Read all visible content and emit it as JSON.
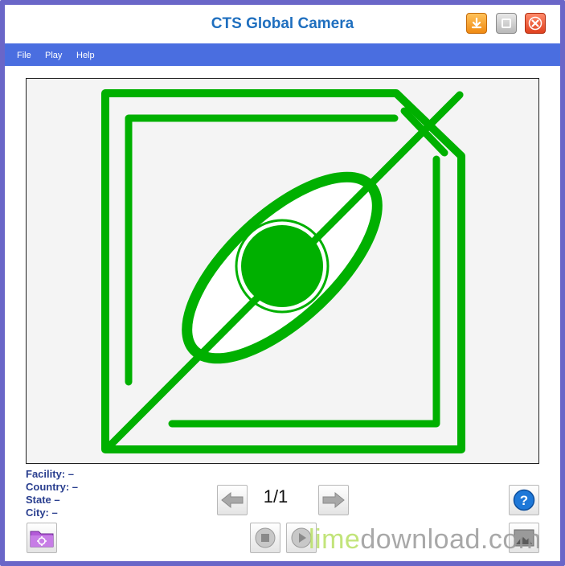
{
  "window": {
    "title": "CTS Global Camera",
    "buttons": [
      "download-icon",
      "maximize-icon",
      "close-icon"
    ]
  },
  "menu": {
    "items": [
      {
        "label": "File"
      },
      {
        "label": "Play"
      },
      {
        "label": "Help"
      }
    ]
  },
  "viewer": {
    "image": "no-camera-eye-icon",
    "accent_color": "#00b000"
  },
  "info": {
    "facility": {
      "label": "Facility:",
      "value": "–"
    },
    "country": {
      "label": "Country:",
      "value": "–"
    },
    "state": {
      "label": "State",
      "value": "–"
    },
    "city": {
      "label": "City:",
      "value": "–"
    }
  },
  "navigation": {
    "counter": "1/1",
    "prev_icon": "arrow-left-icon",
    "next_icon": "arrow-right-icon",
    "stop_icon": "stop-icon",
    "play_icon": "play-icon",
    "help_icon": "help-icon",
    "settings_icon": "folder-settings-icon",
    "snapshot_icon": "image-icon"
  },
  "watermark": {
    "part1": "lime",
    "part2": "download.com"
  }
}
